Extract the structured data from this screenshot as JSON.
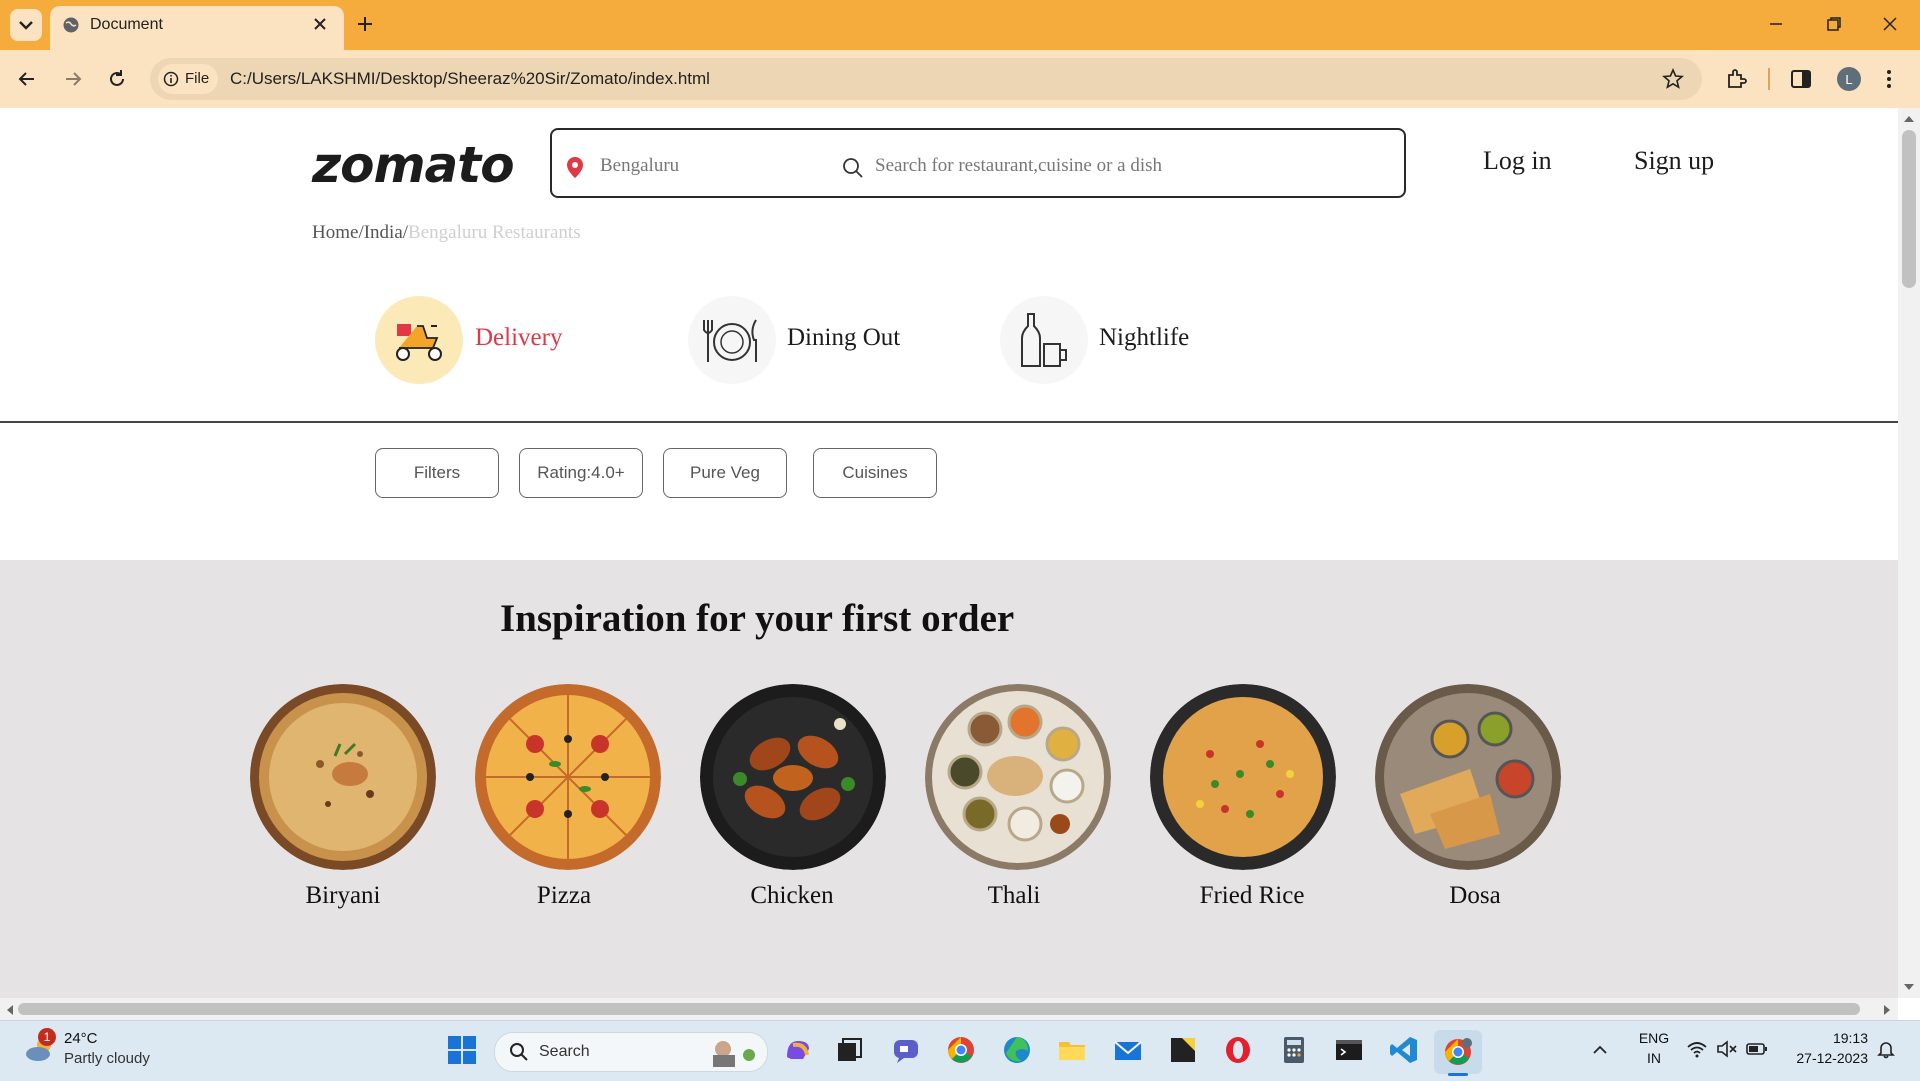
{
  "browser": {
    "tab_title": "Document",
    "file_chip": "File",
    "url": "C:/Users/LAKSHMI/Desktop/Sheeraz%20Sir/Zomato/index.html",
    "profile_initial": "L"
  },
  "header": {
    "logo": "zomato",
    "location": "Bengaluru",
    "search_placeholder": "Search for restaurant,cuisine or a dish",
    "login": "Log in",
    "signup": "Sign up"
  },
  "breadcrumb": {
    "home": "Home",
    "sep1": "/",
    "country": "India",
    "sep2": "/",
    "current": "Bengaluru Restaurants"
  },
  "categories": [
    {
      "label": "Delivery",
      "icon": "delivery-scooter-icon",
      "active": true
    },
    {
      "label": "Dining Out",
      "icon": "dining-plate-icon",
      "active": false
    },
    {
      "label": "Nightlife",
      "icon": "nightlife-bottle-icon",
      "active": false
    }
  ],
  "filters": [
    "Filters",
    "Rating:4.0+",
    "Pure Veg",
    "Cuisines"
  ],
  "inspiration": {
    "title": "Inspiration for your first order",
    "items": [
      "Biryani",
      "Pizza",
      "Chicken",
      "Thali",
      "Fried Rice",
      "Dosa"
    ]
  },
  "taskbar": {
    "weather_temp": "24°C",
    "weather_desc": "Partly cloudy",
    "weather_badge": "1",
    "search": "Search",
    "lang1": "ENG",
    "lang2": "IN",
    "time": "19:13",
    "date": "27-12-2023"
  },
  "colors": {
    "tabbar": "#f6ac3c",
    "toolbar": "#fbe3c2",
    "accent_red": "#e23744",
    "inspiration_bg": "#e5e3e3"
  }
}
